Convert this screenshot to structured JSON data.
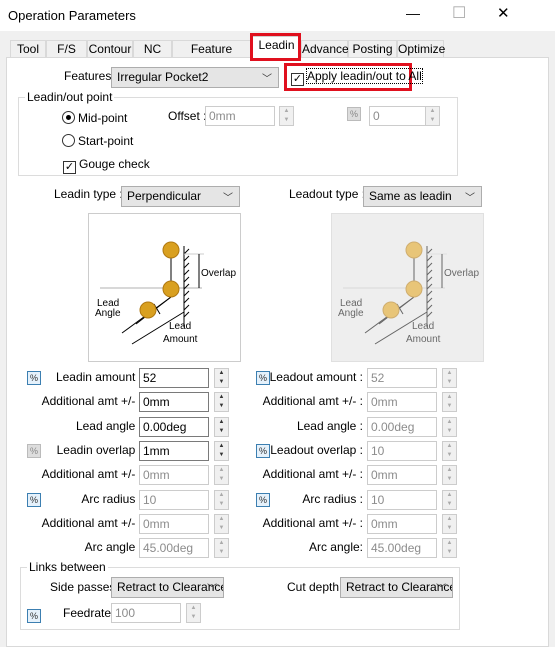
{
  "window": {
    "title": "Operation Parameters",
    "minimize": "—",
    "maximize": "☐",
    "close": "✕"
  },
  "tabs": [
    {
      "label": "Tool"
    },
    {
      "label": "F/S"
    },
    {
      "label": "Contour"
    },
    {
      "label": "NC"
    },
    {
      "label": "Feature Options"
    },
    {
      "label": "Leadin",
      "selected": true
    },
    {
      "label": "Advanced"
    },
    {
      "label": "Posting"
    },
    {
      "label": "Optimize"
    }
  ],
  "features": {
    "label": "Features :",
    "value": "Irregular Pocket2",
    "apply_all_label": "Apply leadin/out to All",
    "apply_all_checked": true
  },
  "point_group": {
    "title": "Leadin/out point",
    "mid_point": "Mid-point",
    "start_point": "Start-point",
    "selected": "Mid-point",
    "gouge_check": "Gouge check",
    "gouge_checked": true,
    "offset_label": "Offset :",
    "offset_value": "0mm",
    "pct_value": "0"
  },
  "leadin": {
    "type_label": "Leadin type :",
    "type_value": "Perpendicular",
    "rows": [
      {
        "label": "Leadin amount :",
        "value": "52"
      },
      {
        "label": "Additional amt +/- :",
        "value": "0mm"
      },
      {
        "label": "Lead angle :",
        "value": "0.00deg"
      },
      {
        "label": "Leadin overlap :",
        "value": "1mm"
      },
      {
        "label": "Additional amt +/- :",
        "value": "0mm"
      },
      {
        "label": "Arc radius :",
        "value": "10"
      },
      {
        "label": "Additional amt +/- :",
        "value": "0mm"
      },
      {
        "label": "Arc angle :",
        "value": "45.00deg"
      }
    ]
  },
  "leadout": {
    "type_label": "Leadout type :",
    "type_value": "Same as leadin",
    "rows": [
      {
        "label": "Leadout amount :",
        "value": "52"
      },
      {
        "label": "Additional amt +/- :",
        "value": "0mm"
      },
      {
        "label": "Lead angle :",
        "value": "0.00deg"
      },
      {
        "label": "Leadout overlap :",
        "value": "10"
      },
      {
        "label": "Additional amt +/- :",
        "value": "0mm"
      },
      {
        "label": "Arc radius :",
        "value": "10"
      },
      {
        "label": "Additional amt +/- :",
        "value": "0mm"
      },
      {
        "label": "Arc angle:",
        "value": "45.00deg"
      }
    ]
  },
  "diagram": {
    "overlap": "Overlap",
    "lead_angle_1": "Lead",
    "lead_angle_2": "Angle",
    "lead_amount_1": "Lead",
    "lead_amount_2": "Amount"
  },
  "links": {
    "title": "Links between",
    "side_label": "Side passes :",
    "side_value": "Retract to Clearance",
    "cut_label": "Cut depth :",
    "cut_value": "Retract to Clearance",
    "feed_label": "Feedrate :",
    "feed_value": "100"
  },
  "pct_symbol": "%",
  "colors": {
    "highlight": "#e0101e",
    "tool": "#d9a020"
  }
}
